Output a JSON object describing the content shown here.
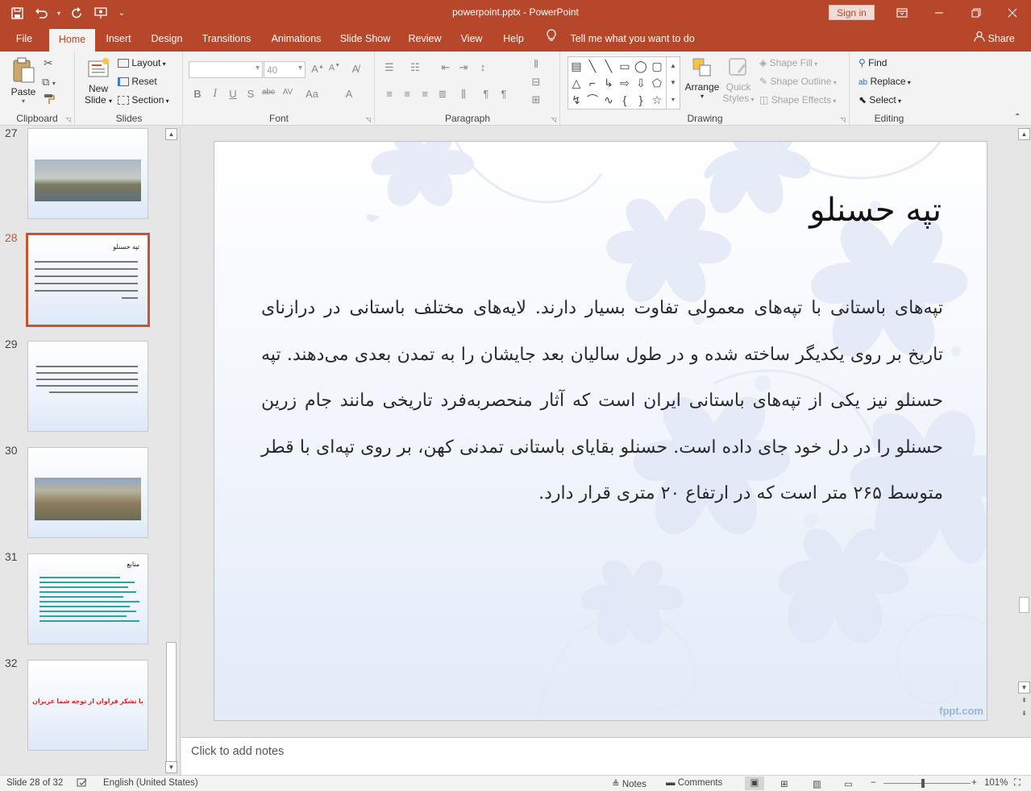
{
  "titlebar": {
    "title": "powerpoint.pptx  -  PowerPoint",
    "sign_in": "Sign in",
    "qat_icons": [
      "save-icon",
      "undo-icon",
      "redo-icon",
      "present-icon",
      "customize-icon"
    ]
  },
  "tabs": [
    "File",
    "Home",
    "Insert",
    "Design",
    "Transitions",
    "Animations",
    "Slide Show",
    "Review",
    "View",
    "Help"
  ],
  "active_tab": "Home",
  "tell_me": "Tell me what you want to do",
  "share": "Share",
  "ribbon": {
    "clipboard": {
      "label": "Clipboard",
      "paste": "Paste"
    },
    "slides": {
      "label": "Slides",
      "new_slide": "New",
      "new_slide2": "Slide",
      "layout": "Layout",
      "reset": "Reset",
      "section": "Section"
    },
    "font": {
      "label": "Font",
      "size": "40"
    },
    "paragraph": {
      "label": "Paragraph"
    },
    "drawing": {
      "label": "Drawing",
      "arrange": "Arrange",
      "quick_styles": "Quick",
      "quick_styles2": "Styles",
      "shape_fill": "Shape Fill",
      "shape_outline": "Shape Outline",
      "shape_effects": "Shape Effects"
    },
    "editing": {
      "label": "Editing",
      "find": "Find",
      "replace": "Replace",
      "select": "Select"
    }
  },
  "thumbnails": [
    {
      "num": "27"
    },
    {
      "num": "28",
      "title": "تپه حسنلو"
    },
    {
      "num": "29"
    },
    {
      "num": "30"
    },
    {
      "num": "31",
      "title": "منابع"
    },
    {
      "num": "32",
      "text": "با تشکر فراوان از توجه شما عزیزان"
    }
  ],
  "selected_slide": "28",
  "slide": {
    "title": "تپه حسنلو",
    "body": "تپه‌های باستانی با تپه‌های معمولی تفاوت بسیار دارند. لایه‌های مختلف باستانی در درازنای تاریخ بر روی یکدیگر ساخته شده و در طول سالیان بعد جایشان را به تمدن بعدی می‌دهند. تپه حسنلو نیز یکی از تپه‌های باستانی ایران است که آثار منحصربه‌فرد تاریخی مانند جام زرین حسنلو را در دل خود جای داده است. حسنلو بقایای باستانی تمدنی کهن، بر روی تپه‌ای با قطر متوسط ۲۶۵ متر است که در ارتفاع ۲۰ متری قرار دارد.",
    "brand": "fppt.com"
  },
  "notes_placeholder": "Click to add notes",
  "status": {
    "slide_info": "Slide 28 of 32",
    "language": "English (United States)",
    "notes": "Notes",
    "comments": "Comments",
    "zoom": "101%"
  }
}
